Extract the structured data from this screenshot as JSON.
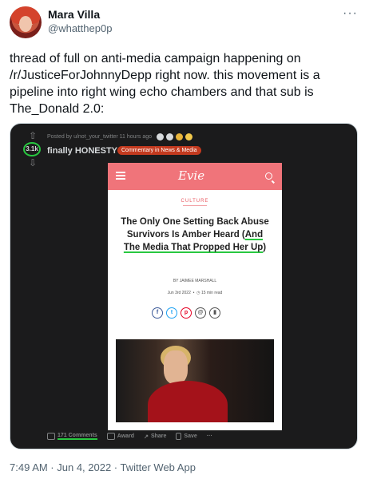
{
  "author": {
    "name": "Mara Villa",
    "handle": "@whatthep0p",
    "more_icon": "more-horizontal-icon"
  },
  "tweet": {
    "text": "thread of full on anti-media campaign happening on /r/JusticeForJohnnyDepp right now. this movement is a pipeline into right wing echo chambers and that sub is The_Donald 2.0:",
    "timestamp": "7:49 AM · Jun 4, 2022 · Twitter Web App"
  },
  "reddit_post": {
    "vote_count": "3.1k",
    "posted_by": "Posted by u/not_your_twitter 11 hours ago",
    "title": "finally HONESTY",
    "flair": "Commentary in News & Media",
    "actions": {
      "comments": "171 Comments",
      "award": "Award",
      "share": "Share",
      "save": "Save",
      "more": "···"
    }
  },
  "article": {
    "logo": "Evie",
    "category": "CULTURE",
    "headline_main": "The Only One Setting Back Abuse Survivors Is Amber Heard (",
    "headline_highlight": "And The Media That Propped Her Up",
    "headline_end": ")",
    "byline": "BY JAIMEE MARSHALL",
    "date": "Jun 3rd 2022",
    "read_time": "15 min read"
  },
  "colors": {
    "highlight_green": "#28c840",
    "reddit_bg": "#1b1b1c",
    "evie_pink": "#f0747a",
    "flair_red": "#c33a1f"
  }
}
